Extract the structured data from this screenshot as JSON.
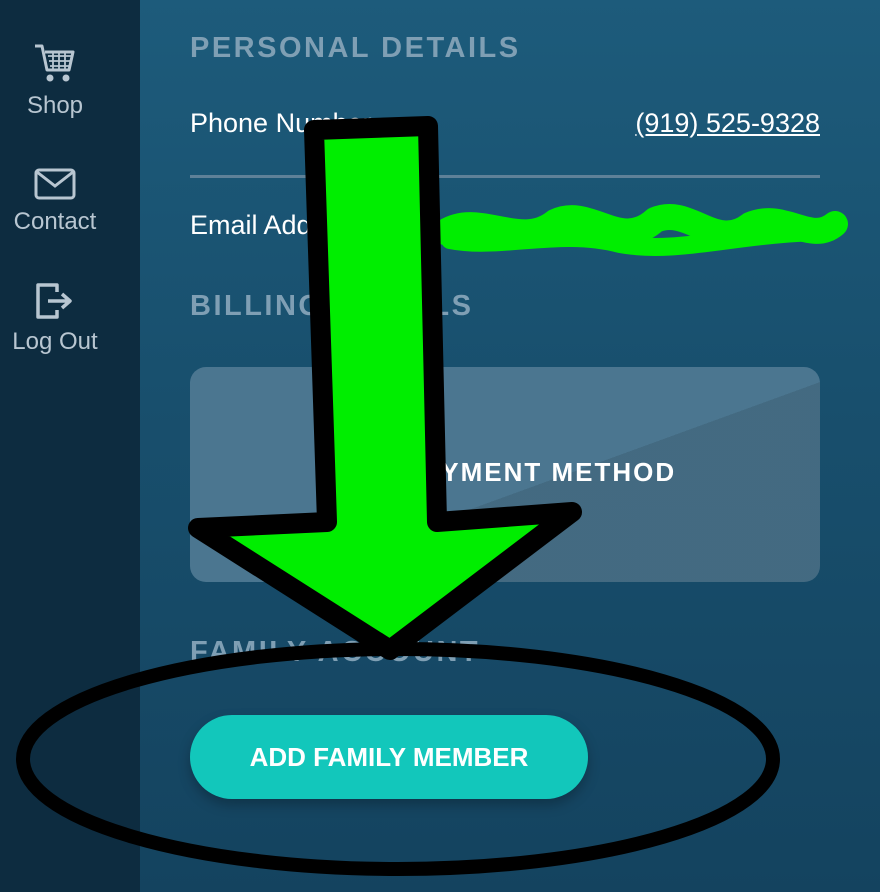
{
  "sidebar": {
    "items": [
      {
        "label": "Shop",
        "icon": "cart-icon"
      },
      {
        "label": "Contact",
        "icon": "envelope-icon"
      },
      {
        "label": "Log Out",
        "icon": "logout-icon"
      }
    ]
  },
  "personal_details": {
    "title": "PERSONAL DETAILS",
    "phone_label": "Phone Number",
    "phone_value": "(919) 525-9328",
    "email_label": "Email Address"
  },
  "billing": {
    "title": "BILLING DETAILS",
    "add_payment_label": "ADD PAYMENT METHOD"
  },
  "family": {
    "title": "FAMILY ACCOUNT",
    "add_member_label": "ADD FAMILY MEMBER"
  },
  "colors": {
    "sidebar_bg": "#0d2c40",
    "main_bg": "#184f6d",
    "accent_teal": "#12c7bb",
    "annotation_green": "#00ee00",
    "annotation_black": "#000000"
  }
}
